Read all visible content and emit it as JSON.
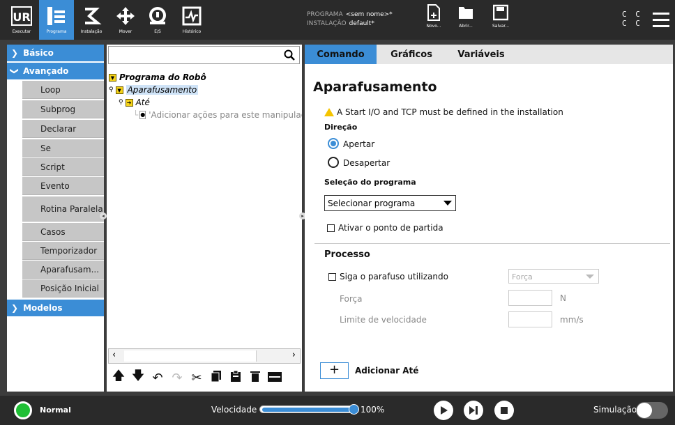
{
  "header": {
    "nav": [
      {
        "label": "Executar",
        "icon": "ur-logo-icon"
      },
      {
        "label": "Programa",
        "icon": "program-icon"
      },
      {
        "label": "Instalação",
        "icon": "installation-icon"
      },
      {
        "label": "Mover",
        "icon": "move-icon"
      },
      {
        "label": "E/S",
        "icon": "io-icon"
      },
      {
        "label": "Histórico",
        "icon": "history-icon"
      }
    ],
    "program_key": "PROGRAMA",
    "program_value": "<sem nome>*",
    "install_key": "INSTALAÇÃO",
    "install_value": "default*",
    "file_buttons": [
      {
        "label": "Novo...",
        "icon": "new-file-icon"
      },
      {
        "label": "Abrir...",
        "icon": "open-folder-icon"
      },
      {
        "label": "Salvar...",
        "icon": "save-icon"
      }
    ],
    "cc_top": "C C",
    "cc_bottom": "C C",
    "accent": "#3b8dd6"
  },
  "leftnav": {
    "basico": "Básico",
    "avancado": "Avançado",
    "modelos": "Modelos",
    "items": [
      "Loop",
      "Subprog",
      "Declarar",
      "Se",
      "Script",
      "Evento",
      "Rotina Paralela",
      "Casos",
      "Temporizador",
      "Aparafusam...",
      "Posição Inicial"
    ]
  },
  "tree": {
    "search_placeholder": "",
    "root": "Programa do Robô",
    "node1": "Aparafusamento",
    "node2": "Até",
    "node3": "'Adicionar ações para este manipulador"
  },
  "tabs": [
    "Comando",
    "Gráficos",
    "Variáveis"
  ],
  "command": {
    "title": "Aparafusamento",
    "warning": "A Start I/O and TCP must be defined in the installation",
    "direction_label": "Direção",
    "radio_tighten": "Apertar",
    "radio_loosen": "Desapertar",
    "program_selection_label": "Seleção do programa",
    "program_select_value": "Selecionar programa",
    "start_point_label": "Ativar o ponto de partida",
    "process_label": "Processo",
    "follow_label": "Siga o parafuso utilizando",
    "follow_select_value": "Força",
    "force_label": "Força",
    "force_unit": "N",
    "speed_limit_label": "Limite de velocidade",
    "speed_unit": "mm/s",
    "add_until_label": "Adicionar Até",
    "add_symbol": "+"
  },
  "footer": {
    "status": "Normal",
    "speed_label": "Velocidade",
    "speed_value": "100%",
    "speed_fraction": 1.0,
    "sim_label": "Simulação",
    "status_color": "#1fbf35"
  }
}
